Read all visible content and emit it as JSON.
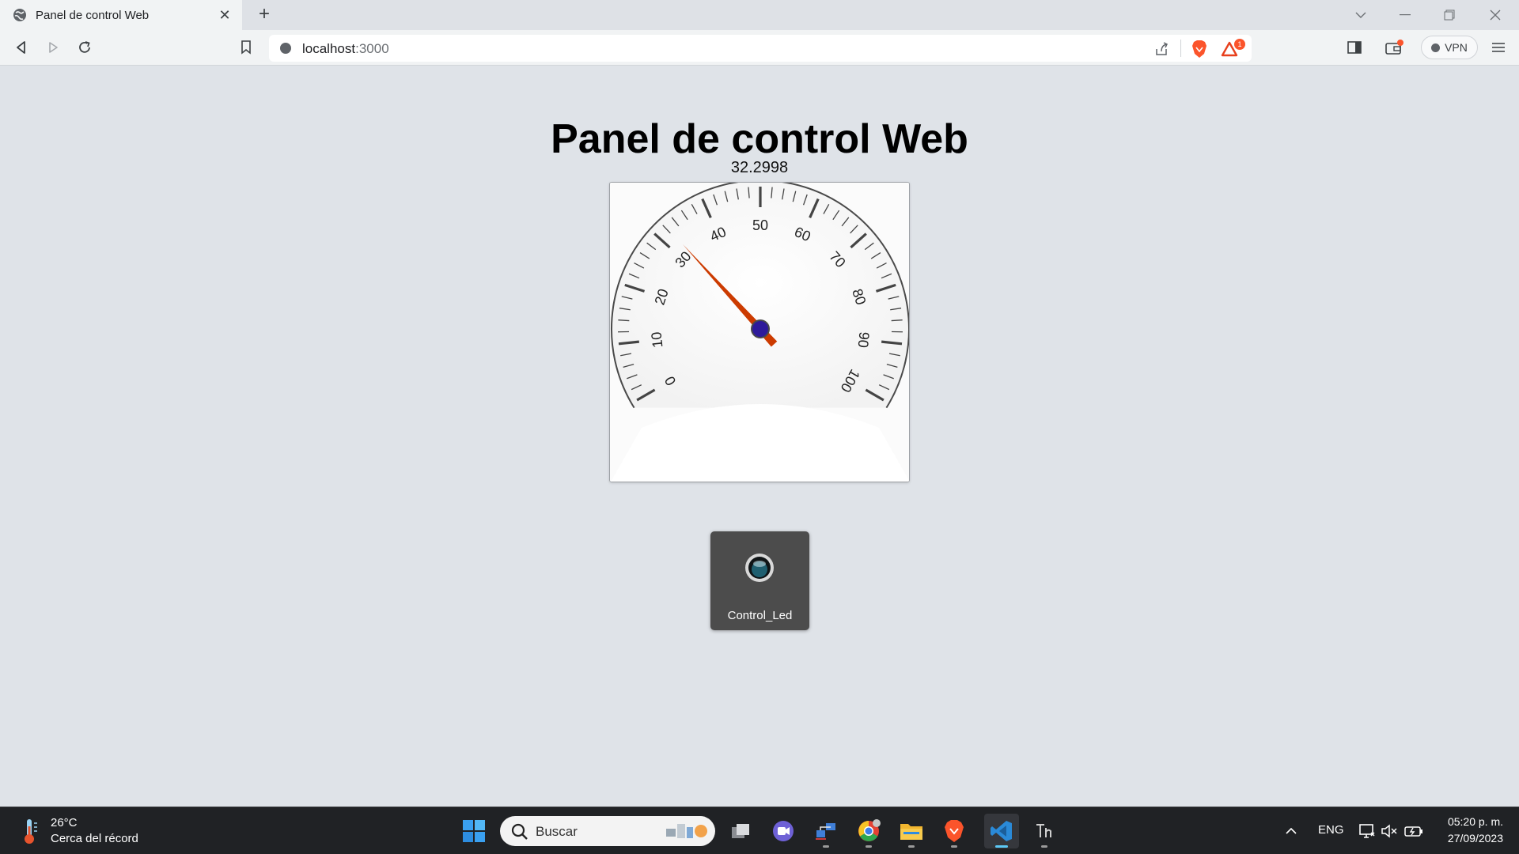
{
  "browser": {
    "tab": {
      "title": "Panel de control Web",
      "icon": "globe-icon"
    },
    "address": {
      "host": "localhost",
      "port": ":3000"
    },
    "shields_badge": "1",
    "vpn_label": "VPN"
  },
  "page": {
    "title": "Panel de control Web",
    "gauge": {
      "value_text": "32.2998",
      "value": 32.2998,
      "min": 0,
      "max": 100,
      "tick_labels": [
        "0",
        "10",
        "20",
        "30",
        "40",
        "50",
        "60",
        "70",
        "80",
        "90",
        "100"
      ],
      "needle_color": "#cc3b00",
      "hub_color": "#2e1a9a"
    },
    "led": {
      "label": "Control_Led",
      "state": "off",
      "icon": "led-indicator-icon"
    }
  },
  "taskbar": {
    "weather": {
      "temp": "26°C",
      "desc": "Cerca del récord"
    },
    "search_placeholder": "Buscar",
    "language": "ENG",
    "clock": {
      "time": "05:20 p. m.",
      "date": "27/09/2023"
    }
  }
}
